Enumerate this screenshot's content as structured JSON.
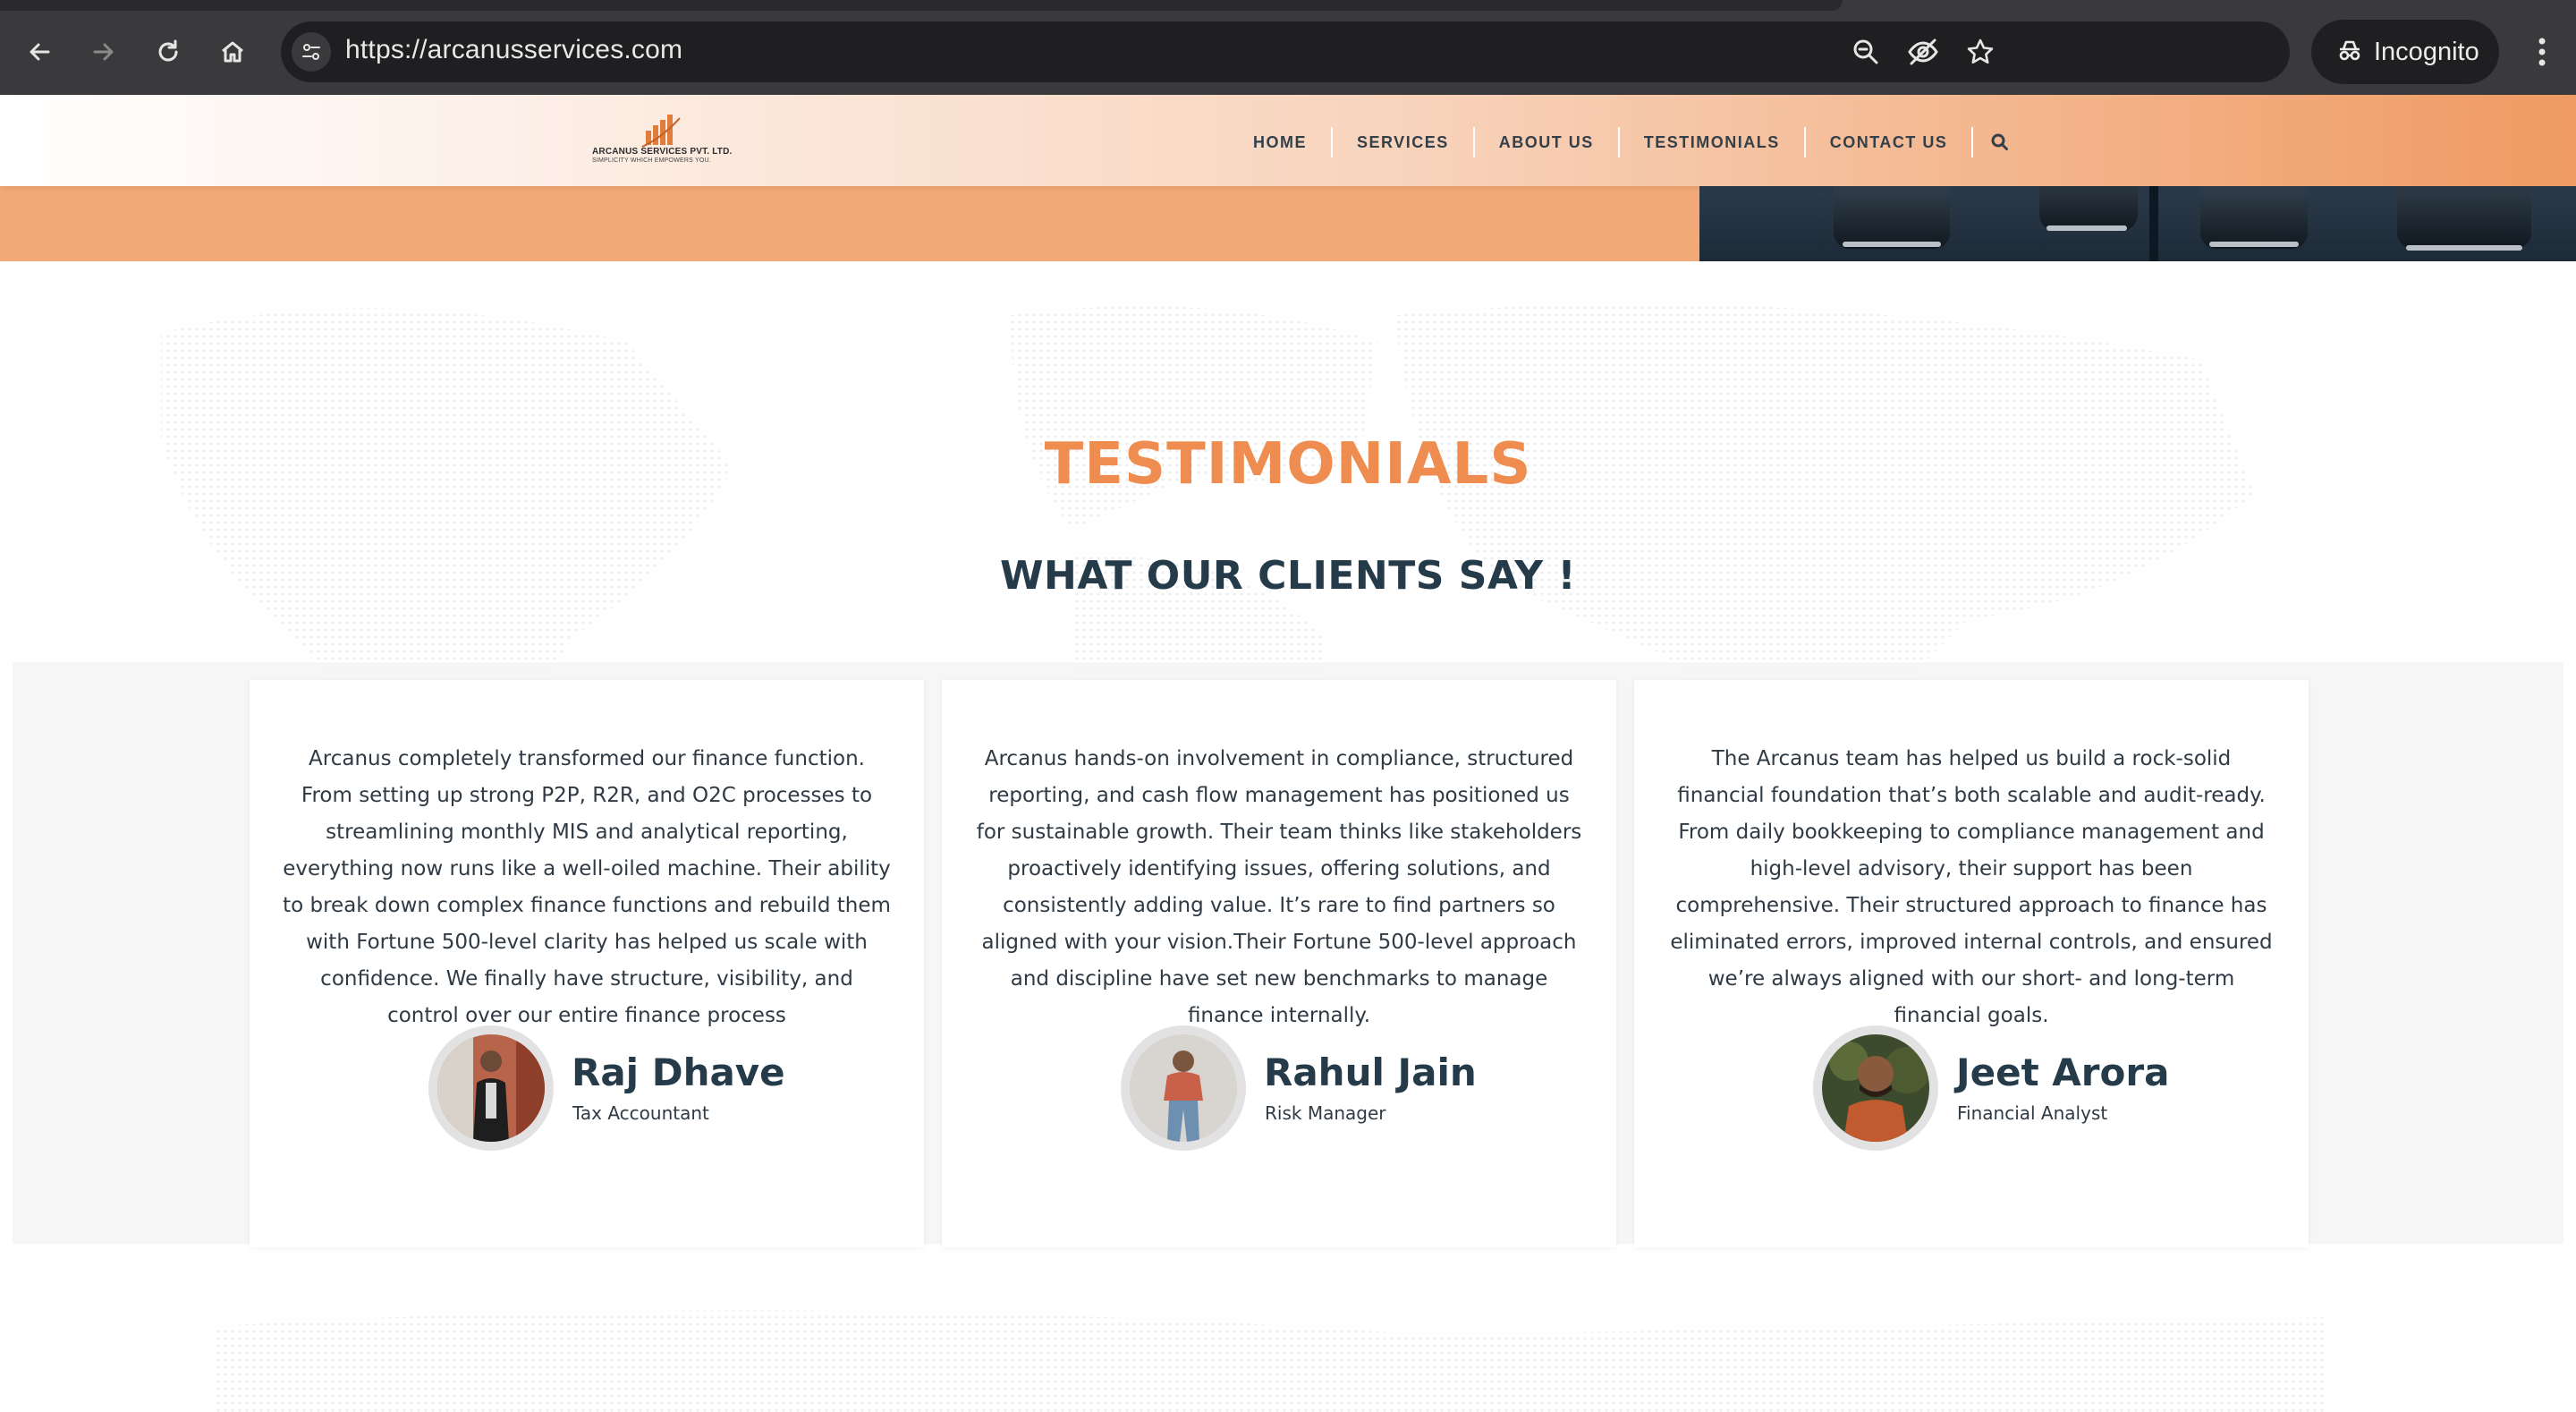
{
  "browser": {
    "url": "https://arcanusservices.com",
    "incognito_label": "Incognito",
    "icons": {
      "back": "back-arrow-icon",
      "forward": "forward-arrow-icon",
      "reload": "reload-icon",
      "home": "home-icon",
      "site_info": "site-settings-icon",
      "zoom": "zoom-icon",
      "tracking": "eye-off-icon",
      "bookmark": "star-icon",
      "incognito": "incognito-icon",
      "menu": "kebab-menu-icon"
    }
  },
  "site": {
    "logo": {
      "name": "ARCANUS SERVICES PVT. LTD.",
      "tagline": "SIMPLICITY WHICH EMPOWERS YOU."
    },
    "nav": [
      {
        "label": "HOME"
      },
      {
        "label": "SERVICES"
      },
      {
        "label": "ABOUT US"
      },
      {
        "label": "TESTIMONIALS"
      },
      {
        "label": "CONTACT US"
      }
    ],
    "search_icon": "search-icon",
    "colors": {
      "accent_orange": "#ef8c4f",
      "banner_orange": "#f2a977",
      "heading_navy": "#253b4a"
    }
  },
  "testimonials": {
    "title": "TESTIMONIALS",
    "subtitle": "WHAT OUR CLIENTS SAY !",
    "cards": [
      {
        "quote": "Arcanus completely transformed our finance function. From setting up strong P2P, R2R, and O2C processes to streamlining monthly MIS and analytical reporting, everything now runs like a well-oiled machine. Their ability to break down complex finance functions and rebuild them with Fortune 500-level clarity has helped us scale with confidence. We finally have structure, visibility, and control over our entire finance process",
        "name": "Raj Dhave",
        "role": "Tax Accountant"
      },
      {
        "quote": "Arcanus hands-on involvement in compliance, structured reporting, and cash flow management has positioned us for sustainable growth. Their team thinks like stakeholders proactively identifying issues, offering solutions, and consistently adding value. It’s rare to find partners so aligned with your vision.Their Fortune 500-level approach and discipline have set new benchmarks to manage finance internally.",
        "name": "Rahul Jain",
        "role": "Risk Manager"
      },
      {
        "quote": "The Arcanus team has helped us build a rock-solid financial foundation that’s both scalable and audit-ready. From daily bookkeeping to compliance management and high-level advisory, their support has been comprehensive. Their structured approach to finance has eliminated errors, improved internal controls, and ensured we’re always aligned with our short- and long-term financial goals.",
        "name": "Jeet Arora",
        "role": "Financial Analyst"
      }
    ]
  }
}
